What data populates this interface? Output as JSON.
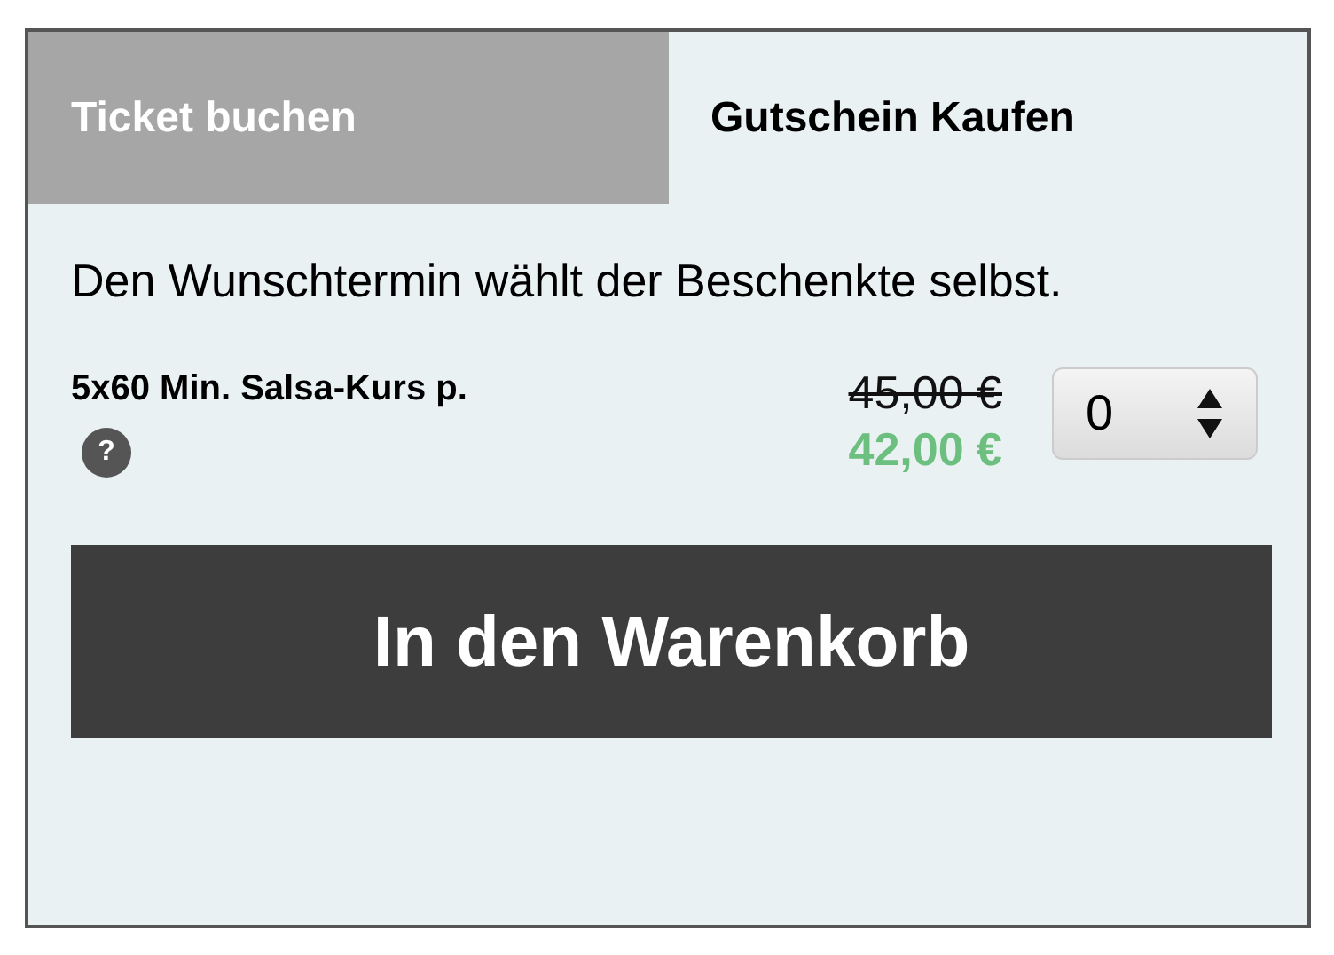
{
  "tabs": [
    {
      "label": "Ticket buchen",
      "selected": false
    },
    {
      "label": "Gutschein Kaufen",
      "selected": true
    }
  ],
  "description": "Den Wunschtermin wählt der Beschenkte selbst.",
  "product": {
    "name": "5x60 Min. Salsa-Kurs p.",
    "help": "?",
    "old_price": "45,00 €",
    "price": "42,00 €",
    "quantity": "0"
  },
  "button": "In den Warenkorb"
}
